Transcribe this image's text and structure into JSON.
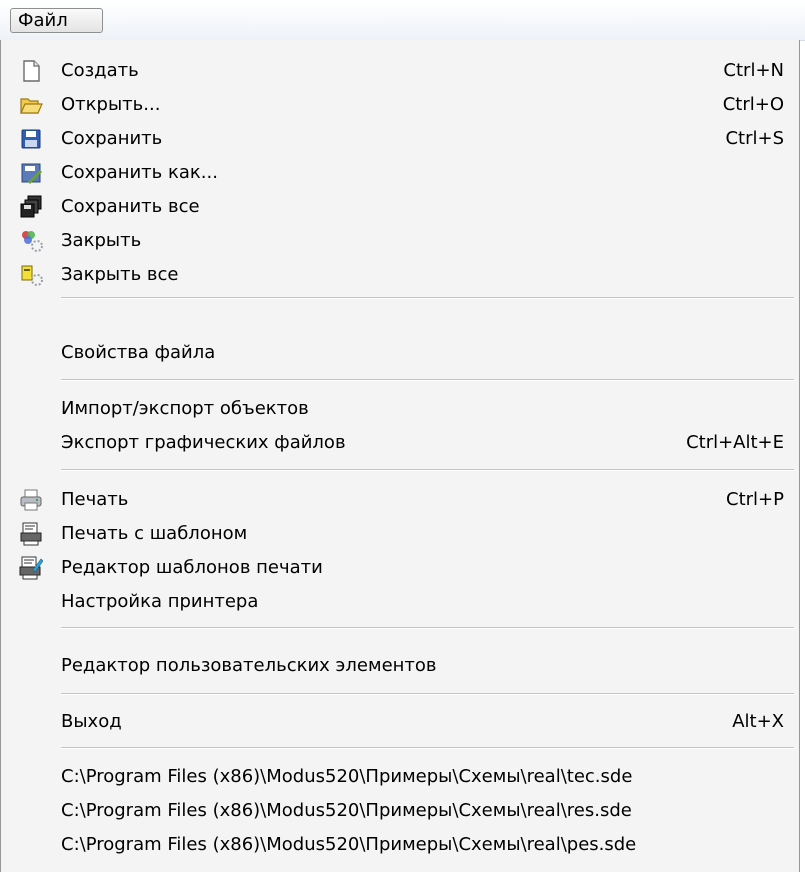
{
  "menu": {
    "title": "Файл",
    "items": [
      {
        "label": "Создать",
        "shortcut": "Ctrl+N",
        "icon": "new-file-icon"
      },
      {
        "label": "Открыть...",
        "shortcut": "Ctrl+O",
        "icon": "open-folder-icon"
      },
      {
        "label": "Сохранить",
        "shortcut": "Ctrl+S",
        "icon": "save-icon"
      },
      {
        "label": "Сохранить как...",
        "shortcut": "",
        "icon": "save-as-icon"
      },
      {
        "label": "Сохранить все",
        "shortcut": "",
        "icon": "save-all-icon"
      },
      {
        "label": "Закрыть",
        "shortcut": "",
        "icon": "close-icon"
      },
      {
        "label": "Закрыть все",
        "shortcut": "",
        "icon": "close-all-icon"
      },
      {
        "label": "Свойства файла",
        "shortcut": ""
      },
      {
        "label": "Импорт/экспорт объектов",
        "shortcut": ""
      },
      {
        "label": "Экспорт графических файлов",
        "shortcut": "Ctrl+Alt+E"
      },
      {
        "label": "Печать",
        "shortcut": "Ctrl+P",
        "icon": "printer-icon"
      },
      {
        "label": "Печать с шаблоном",
        "shortcut": "",
        "icon": "print-template-icon"
      },
      {
        "label": "Редактор шаблонов печати",
        "shortcut": "",
        "icon": "template-editor-icon"
      },
      {
        "label": "Настройка принтера",
        "shortcut": ""
      },
      {
        "label": "Редактор пользовательских элементов",
        "shortcut": ""
      },
      {
        "label": "Выход",
        "shortcut": "Alt+X"
      }
    ],
    "recent_files": [
      "C:\\Program Files (x86)\\Modus520\\Примеры\\Схемы\\real\\tec.sde",
      "C:\\Program Files (x86)\\Modus520\\Примеры\\Схемы\\real\\res.sde",
      "C:\\Program Files (x86)\\Modus520\\Примеры\\Схемы\\real\\pes.sde"
    ]
  }
}
